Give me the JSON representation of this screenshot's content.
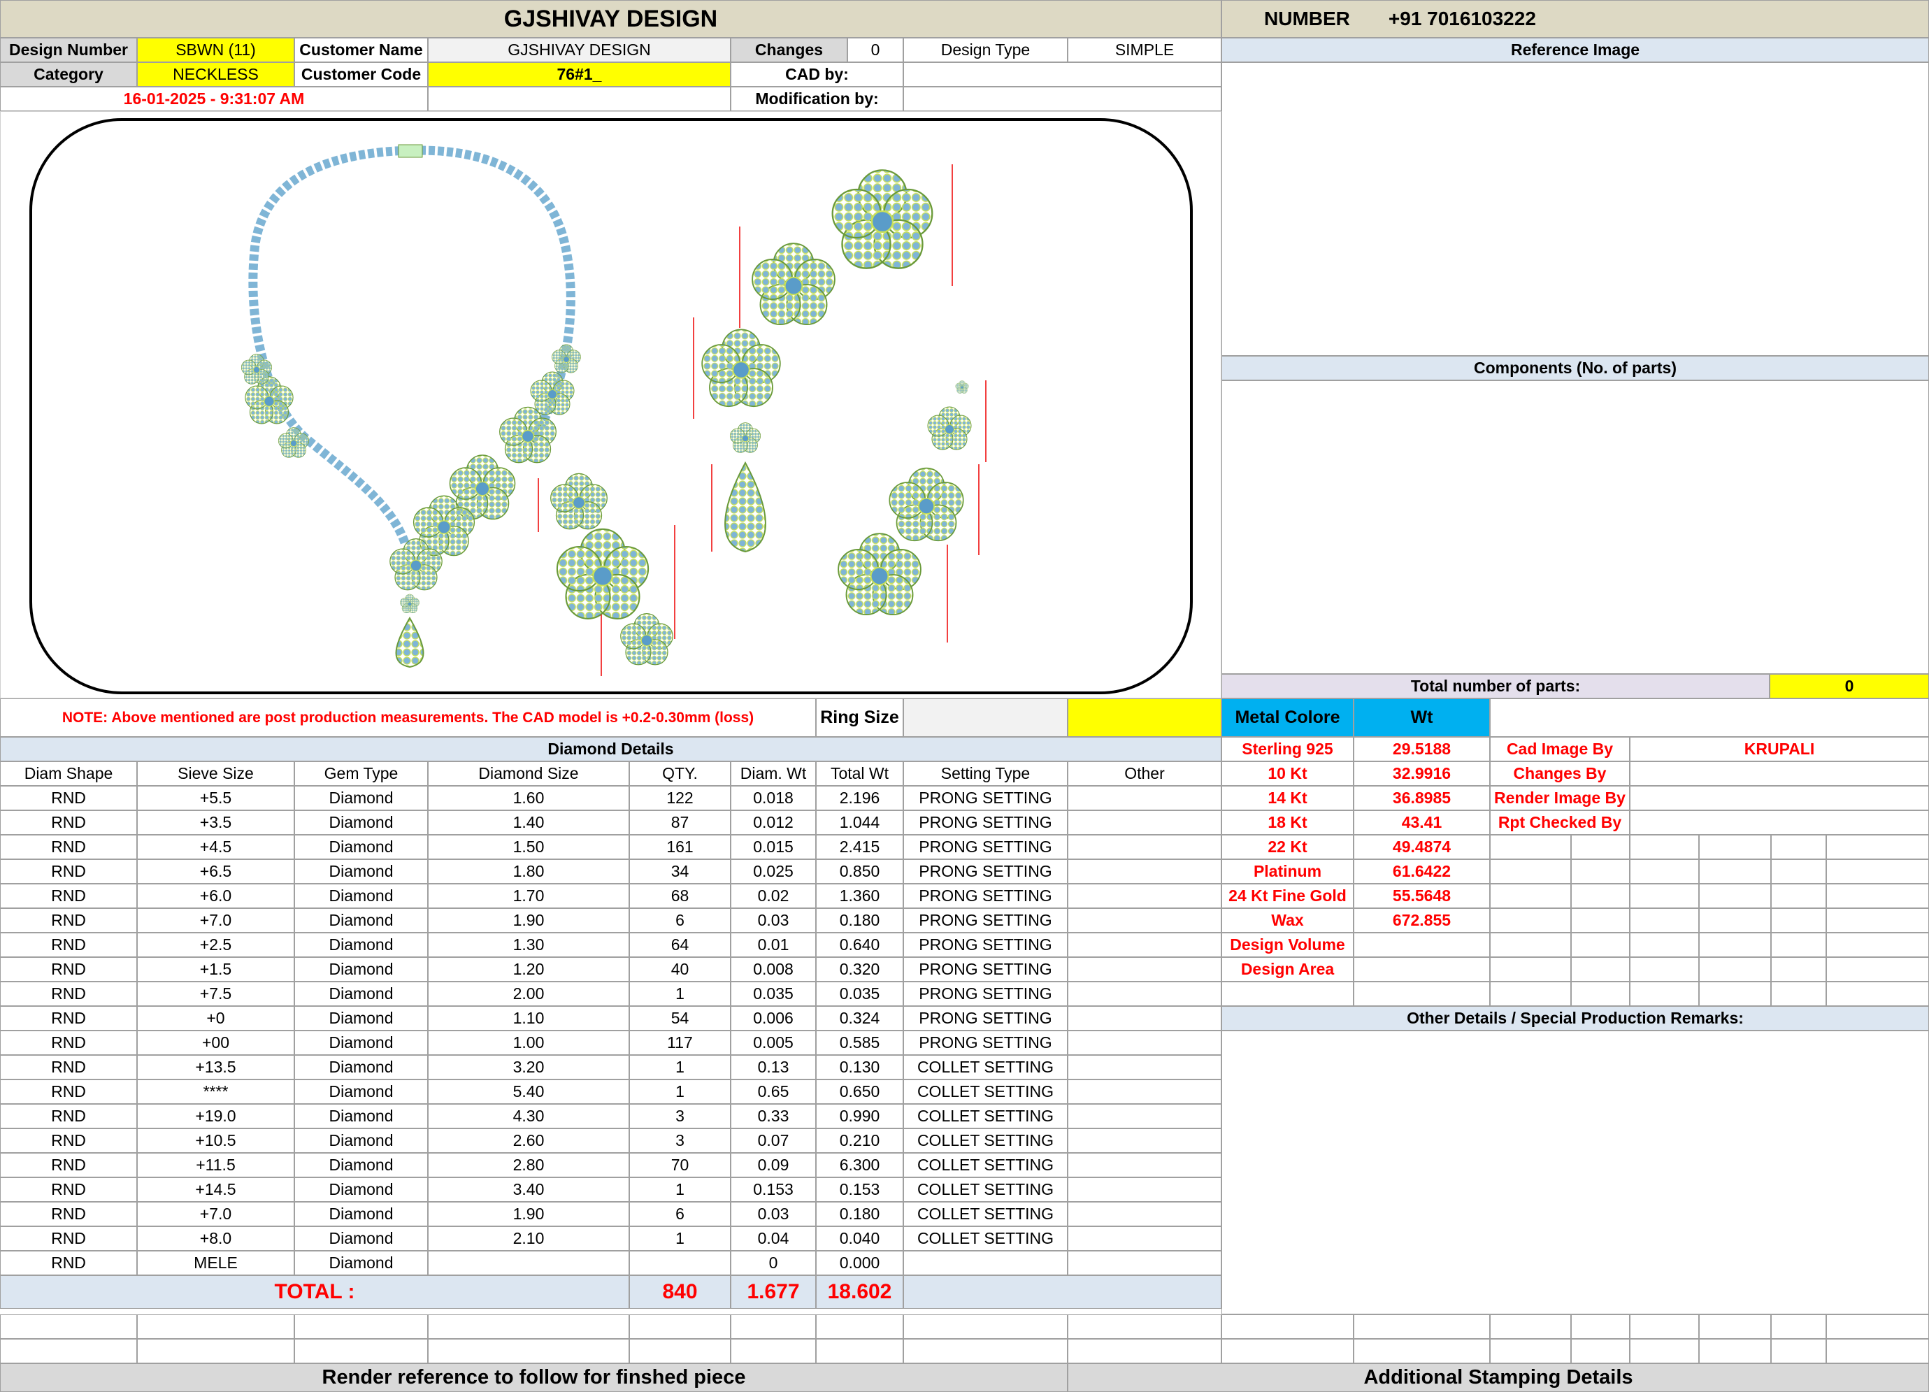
{
  "header": {
    "company": "GJSHIVAY DESIGN",
    "number_label": "NUMBER",
    "number_value": "+91 7016103222"
  },
  "info": {
    "design_number_label": "Design Number",
    "design_number": "SBWN (11)",
    "customer_name_label": "Customer Name",
    "customer_name": "GJSHIVAY DESIGN",
    "changes_label": "Changes",
    "changes": "0",
    "design_type_label": "Design Type",
    "design_type": "SIMPLE",
    "category_label": "Category",
    "category": "NECKLESS",
    "customer_code_label": "Customer Code",
    "customer_code": "76#1_",
    "cad_by_label": "CAD by:",
    "cad_by": "",
    "datetime": "16-01-2025 - 9:31:07 AM",
    "modification_by_label": "Modification by:",
    "modification_by": ""
  },
  "right_panel": {
    "reference_image": "Reference Image",
    "components": "Components (No. of parts)",
    "total_parts_label": "Total number of parts:",
    "total_parts": "0",
    "other_details": "Other Details / Special Production Remarks:",
    "additional_stamping": "Additional Stamping Details"
  },
  "note": "NOTE: Above mentioned are post production measurements. The CAD model is +0.2-0.30mm (loss)",
  "ring_size_label": "Ring Size",
  "metal": {
    "col1": "Metal Colore",
    "col2": "Wt",
    "rows": [
      {
        "name": "Sterling 925",
        "wt": "29.5188"
      },
      {
        "name": "10 Kt",
        "wt": "32.9916"
      },
      {
        "name": "14 Kt",
        "wt": "36.8985"
      },
      {
        "name": "18 Kt",
        "wt": "43.41"
      },
      {
        "name": "22 Kt",
        "wt": "49.4874"
      },
      {
        "name": "Platinum",
        "wt": "61.6422"
      },
      {
        "name": "24 Kt Fine Gold",
        "wt": "55.5648"
      },
      {
        "name": "Wax",
        "wt": "672.855"
      },
      {
        "name": "Design Volume",
        "wt": ""
      },
      {
        "name": "Design Area",
        "wt": ""
      }
    ]
  },
  "credits": [
    {
      "label": "Cad Image By",
      "value": "KRUPALI"
    },
    {
      "label": "Changes By",
      "value": ""
    },
    {
      "label": "Render Image By",
      "value": ""
    },
    {
      "label": "Rpt Checked By",
      "value": ""
    }
  ],
  "diamond": {
    "title": "Diamond Details",
    "headers": [
      "Diam Shape",
      "Sieve Size",
      "Gem Type",
      "Diamond Size",
      "QTY.",
      "Diam. Wt",
      "Total Wt",
      "Setting Type",
      "Other"
    ],
    "rows": [
      [
        "RND",
        "+5.5",
        "Diamond",
        "1.60",
        "122",
        "0.018",
        "2.196",
        "PRONG SETTING",
        ""
      ],
      [
        "RND",
        "+3.5",
        "Diamond",
        "1.40",
        "87",
        "0.012",
        "1.044",
        "PRONG SETTING",
        ""
      ],
      [
        "RND",
        "+4.5",
        "Diamond",
        "1.50",
        "161",
        "0.015",
        "2.415",
        "PRONG SETTING",
        ""
      ],
      [
        "RND",
        "+6.5",
        "Diamond",
        "1.80",
        "34",
        "0.025",
        "0.850",
        "PRONG SETTING",
        ""
      ],
      [
        "RND",
        "+6.0",
        "Diamond",
        "1.70",
        "68",
        "0.02",
        "1.360",
        "PRONG SETTING",
        ""
      ],
      [
        "RND",
        "+7.0",
        "Diamond",
        "1.90",
        "6",
        "0.03",
        "0.180",
        "PRONG SETTING",
        ""
      ],
      [
        "RND",
        "+2.5",
        "Diamond",
        "1.30",
        "64",
        "0.01",
        "0.640",
        "PRONG SETTING",
        ""
      ],
      [
        "RND",
        "+1.5",
        "Diamond",
        "1.20",
        "40",
        "0.008",
        "0.320",
        "PRONG SETTING",
        ""
      ],
      [
        "RND",
        "+7.5",
        "Diamond",
        "2.00",
        "1",
        "0.035",
        "0.035",
        "PRONG SETTING",
        ""
      ],
      [
        "RND",
        "+0",
        "Diamond",
        "1.10",
        "54",
        "0.006",
        "0.324",
        "PRONG SETTING",
        ""
      ],
      [
        "RND",
        "+00",
        "Diamond",
        "1.00",
        "117",
        "0.005",
        "0.585",
        "PRONG SETTING",
        ""
      ],
      [
        "RND",
        "+13.5",
        "Diamond",
        "3.20",
        "1",
        "0.13",
        "0.130",
        "COLLET SETTING",
        ""
      ],
      [
        "RND",
        "****",
        "Diamond",
        "5.40",
        "1",
        "0.65",
        "0.650",
        "COLLET SETTING",
        ""
      ],
      [
        "RND",
        "+19.0",
        "Diamond",
        "4.30",
        "3",
        "0.33",
        "0.990",
        "COLLET SETTING",
        ""
      ],
      [
        "RND",
        "+10.5",
        "Diamond",
        "2.60",
        "3",
        "0.07",
        "0.210",
        "COLLET SETTING",
        ""
      ],
      [
        "RND",
        "+11.5",
        "Diamond",
        "2.80",
        "70",
        "0.09",
        "6.300",
        "COLLET SETTING",
        ""
      ],
      [
        "RND",
        "+14.5",
        "Diamond",
        "3.40",
        "1",
        "0.153",
        "0.153",
        "COLLET SETTING",
        ""
      ],
      [
        "RND",
        "+7.0",
        "Diamond",
        "1.90",
        "6",
        "0.03",
        "0.180",
        "COLLET SETTING",
        ""
      ],
      [
        "RND",
        "+8.0",
        "Diamond",
        "2.10",
        "1",
        "0.04",
        "0.040",
        "COLLET SETTING",
        ""
      ],
      [
        "RND",
        "MELE",
        "Diamond",
        "",
        "",
        "0",
        "0.000",
        "",
        ""
      ]
    ],
    "total_label": "TOTAL :",
    "total_qty": "840",
    "total_diam_wt": "1.677",
    "total_wt": "18.602"
  },
  "footer": {
    "render_reference": "Render reference to follow for finshed piece"
  },
  "colors": {
    "highlight": "#ffff00",
    "header_bg": "#dce6f1",
    "title_bg": "#ddd9c4",
    "accent_text": "#ff0000",
    "metal_header": "#00b0f0",
    "gem": "#7fb5d6",
    "metal_outline": "#c8e05a"
  }
}
